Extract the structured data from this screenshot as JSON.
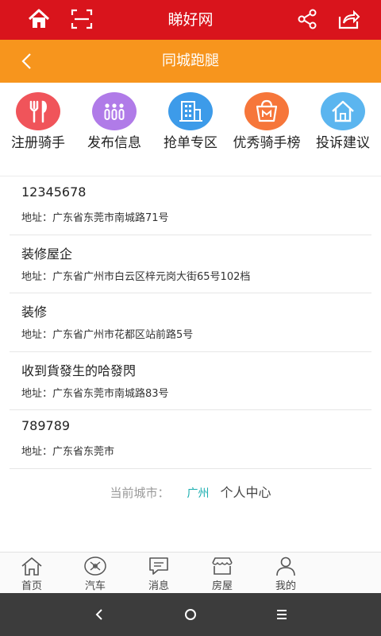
{
  "header": {
    "title": "睇好网"
  },
  "subheader": {
    "title": "同城跑腿"
  },
  "quick_actions": [
    {
      "label": "注册骑手",
      "color": "#f0545a",
      "icon": "fork-knife-icon"
    },
    {
      "label": "发布信息",
      "color": "#b07be8",
      "icon": "people-icon"
    },
    {
      "label": "抢单专区",
      "color": "#3d9be9",
      "icon": "building-icon"
    },
    {
      "label": "优秀骑手榜",
      "color": "#f6763a",
      "icon": "bag-icon"
    },
    {
      "label": "投诉建议",
      "color": "#5bb5ef",
      "icon": "house-icon"
    }
  ],
  "listings": [
    {
      "name": "12345678",
      "address": "地址：广东省东莞市南城路71号"
    },
    {
      "name": "装修屋企",
      "address": "地址：广东省广州市白云区梓元岗大街65号102档"
    },
    {
      "name": "装修",
      "address": "地址：广东省广州市花都区站前路5号"
    },
    {
      "name": "收到貨發生的哈發閃",
      "address": "地址：广东省东莞市南城路83号"
    },
    {
      "name": "789789",
      "address": "地址：广东省东莞市"
    }
  ],
  "city_bar": {
    "label": "当前城市：",
    "city": "广州",
    "personal_center": "个人中心"
  },
  "tabs": [
    {
      "label": "首页",
      "icon": "home-icon"
    },
    {
      "label": "汽车",
      "icon": "car-icon"
    },
    {
      "label": "消息",
      "icon": "message-icon"
    },
    {
      "label": "房屋",
      "icon": "shop-icon"
    },
    {
      "label": "我的",
      "icon": "user-icon"
    }
  ],
  "colors": {
    "header": "#d9141c",
    "subheader": "#f7951d",
    "city_link": "#1aaeb0",
    "system_bar": "#3c3c3c"
  }
}
